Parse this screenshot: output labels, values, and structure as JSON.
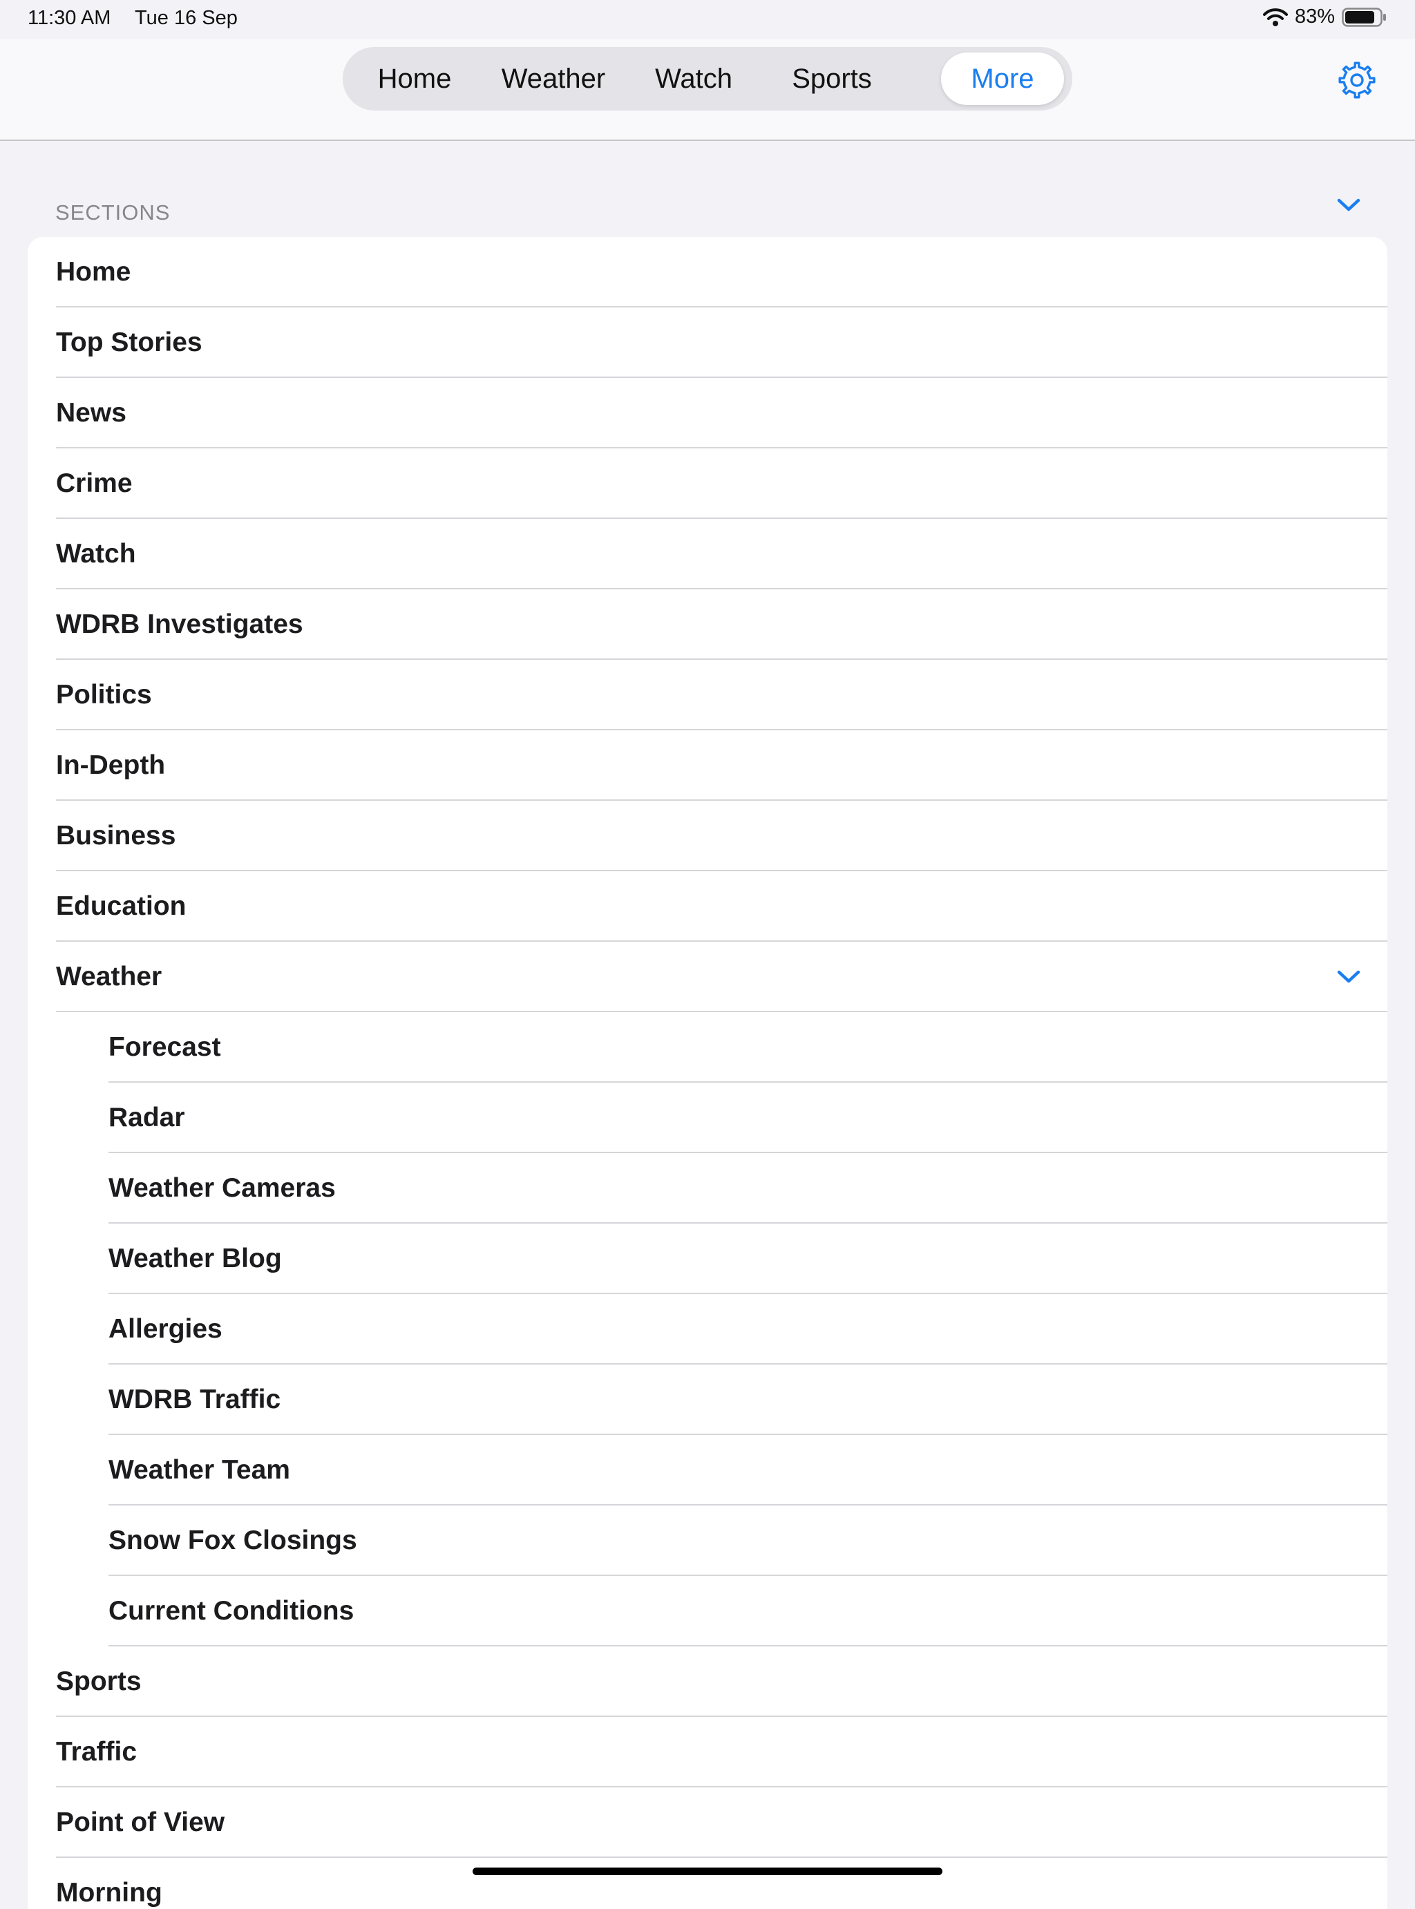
{
  "status_bar": {
    "time": "11:30 AM",
    "date": "Tue 16 Sep",
    "battery": "83%"
  },
  "tabs": [
    {
      "label": "Home"
    },
    {
      "label": "Weather"
    },
    {
      "label": "Watch"
    },
    {
      "label": "Sports"
    },
    {
      "label": "More",
      "active": true
    }
  ],
  "settings_icon": "gear-icon",
  "accent_color": "#1a7ef0",
  "sections": {
    "header": "SECTIONS",
    "expanded": true,
    "items": [
      {
        "label": "Home"
      },
      {
        "label": "Top Stories"
      },
      {
        "label": "News"
      },
      {
        "label": "Crime"
      },
      {
        "label": "Watch"
      },
      {
        "label": "WDRB Investigates"
      },
      {
        "label": "Politics"
      },
      {
        "label": "In-Depth"
      },
      {
        "label": "Business"
      },
      {
        "label": "Education"
      },
      {
        "label": "Weather",
        "expanded": true
      },
      {
        "label": "Forecast",
        "sub": true
      },
      {
        "label": "Radar",
        "sub": true
      },
      {
        "label": "Weather Cameras",
        "sub": true
      },
      {
        "label": "Weather Blog",
        "sub": true
      },
      {
        "label": "Allergies",
        "sub": true
      },
      {
        "label": "WDRB Traffic",
        "sub": true
      },
      {
        "label": "Weather Team",
        "sub": true
      },
      {
        "label": "Snow Fox Closings",
        "sub": true
      },
      {
        "label": "Current Conditions",
        "sub": true
      },
      {
        "label": "Sports"
      },
      {
        "label": "Traffic"
      },
      {
        "label": "Point of View"
      },
      {
        "label": "Morning"
      }
    ]
  }
}
